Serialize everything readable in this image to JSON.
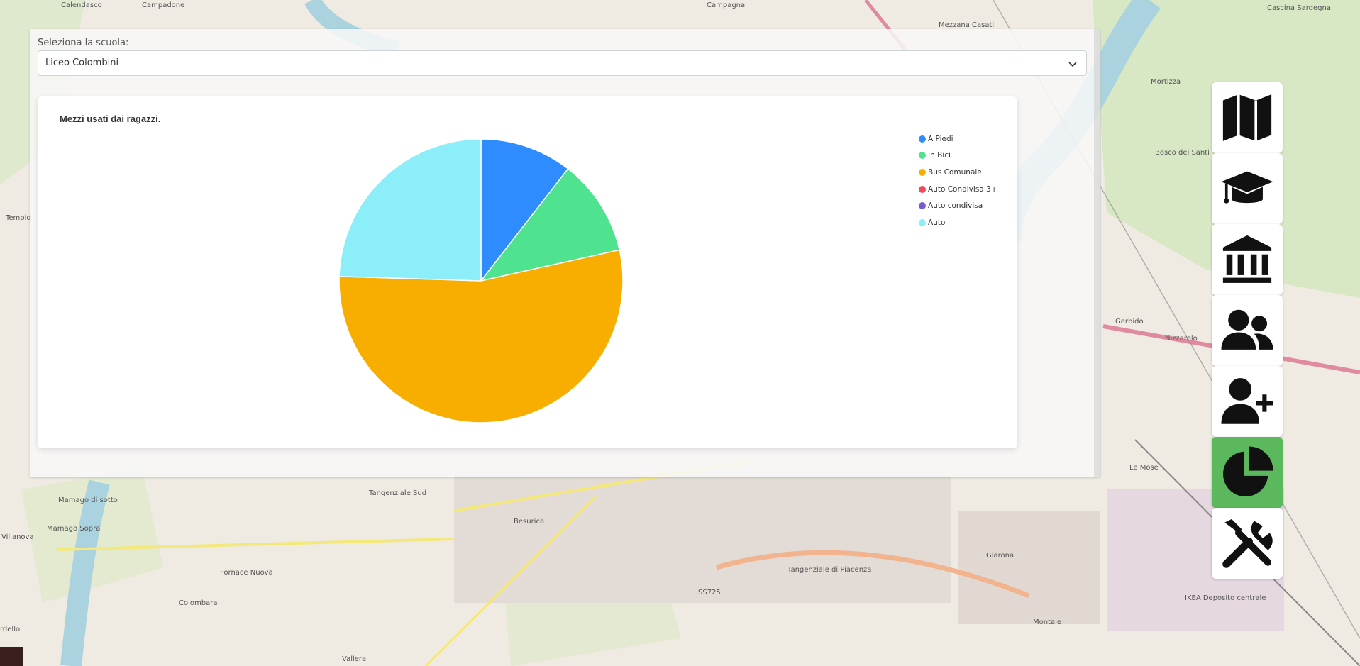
{
  "map": {
    "labels": [
      "Calendasco",
      "Campadone",
      "Campagna",
      "Mezzana Casati",
      "Cascina Sardegna",
      "Mortizza",
      "Bosco dei Santi",
      "Tempio",
      "Gerbido",
      "Nizzarolo",
      "Le Mose",
      "Besurica",
      "Mamago di sotto",
      "Mamago Sopra",
      "Villanova",
      "Fornace Nuova",
      "Colombara",
      "Giarona",
      "Montale",
      "Tangenziale Sud",
      "Tangenziale di Piacenza",
      "SS725",
      "IKEA Deposito centrale",
      "Vallera",
      "rdello"
    ]
  },
  "panel": {
    "school_label": "Seleziona la scuola:",
    "school_selected": "Liceo Colombini"
  },
  "chart_data": {
    "type": "pie",
    "title": "Mezzi usati dai ragazzi.",
    "categories": [
      "A Piedi",
      "In Bici",
      "Bus Comunale",
      "Auto Condivisa 3+",
      "Auto condivisa",
      "Auto"
    ],
    "values": [
      10.5,
      11,
      54,
      0,
      0,
      24.5
    ],
    "colors": [
      "#2f8cff",
      "#4fe28f",
      "#f7ae00",
      "#f04a5c",
      "#7a5bcf",
      "#8ceef8"
    ],
    "legend_position": "top-right"
  },
  "toolbar": {
    "buttons": [
      {
        "icon": "map-icon",
        "active": false
      },
      {
        "icon": "graduation-cap-icon",
        "active": false
      },
      {
        "icon": "institution-icon",
        "active": false
      },
      {
        "icon": "users-icon",
        "active": false
      },
      {
        "icon": "user-plus-icon",
        "active": false
      },
      {
        "icon": "pie-chart-icon",
        "active": true
      },
      {
        "icon": "tools-icon",
        "active": false
      }
    ],
    "active_color": "#5cb85c"
  }
}
